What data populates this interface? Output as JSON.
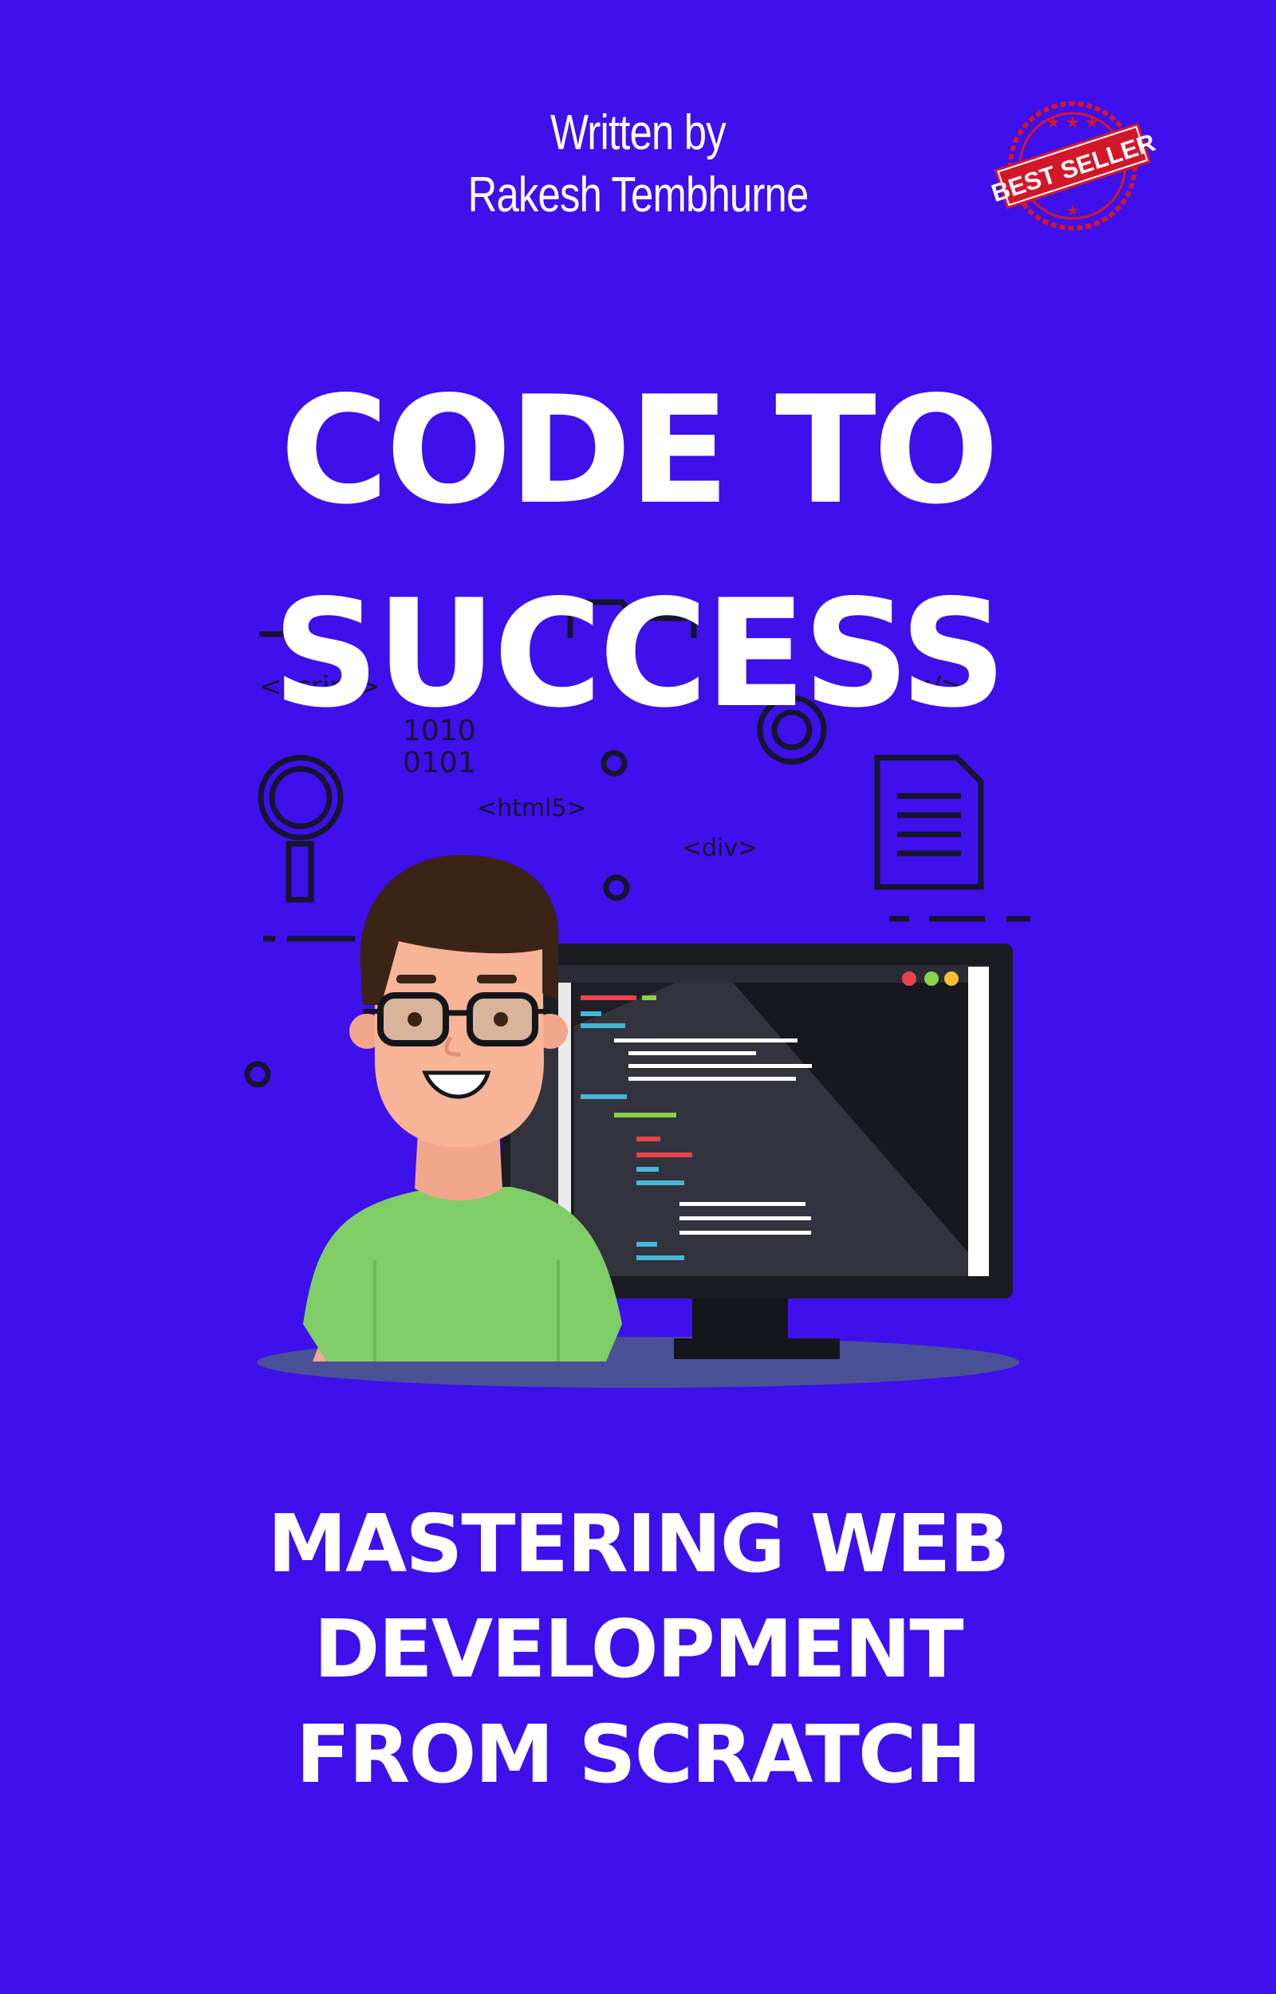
{
  "cover": {
    "background_color": "#3d10ec",
    "byline": {
      "line1": "Written by",
      "line2": "Rakesh Tembhurne"
    },
    "badge": {
      "text": "BEST SELLER",
      "color": "#d3172a"
    },
    "title": {
      "line1": "CODE TO",
      "line2": "SUCCESS"
    },
    "illustration": {
      "tags": {
        "script": "<script>",
        "html5": "<html5>",
        "div": "<div>",
        "closing": "</>"
      },
      "binary": {
        "line1": "1010",
        "line2": "0101"
      },
      "person_shirt_color": "#7fcd67",
      "monitor_color": "#1b1b22"
    },
    "subtitle": {
      "line1": "MASTERING WEB",
      "line2": "DEVELOPMENT",
      "line3": "FROM SCRATCH"
    }
  }
}
